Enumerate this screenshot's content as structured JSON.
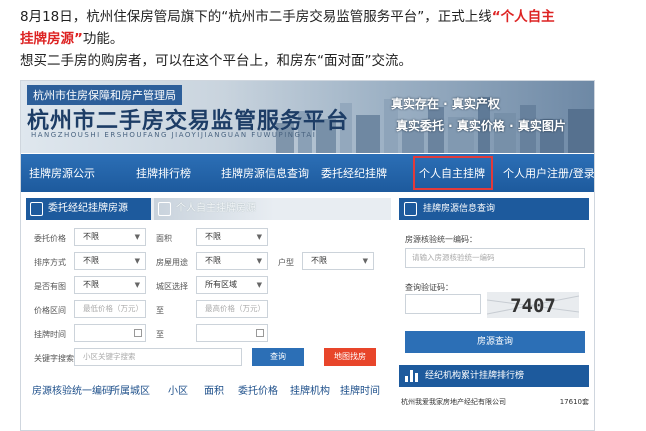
{
  "intro": {
    "line1_a": "8月18日，杭州住保房管局旗下的“杭州市二手房交易监管服务平台”，正式上线",
    "line1_b": "“个人自主",
    "line2_a": "挂牌房源”",
    "line2_b": "功能。",
    "line3": "想买二手房的购房者，可以在这个平台上，和房东“面对面”交流。"
  },
  "banner": {
    "org": "杭州市住房保障和房产管理局",
    "title": "杭州市二手房交易监管服务平台",
    "pinyin": "HANGZHOUSHI ERSHOUFANG JIAOYIJIANGUAN FUWUPINGTAI",
    "slogan1": "真实存在 · 真实产权",
    "slogan2": "真实委托 · 真实价格 · 真实图片"
  },
  "nav": {
    "items": [
      "挂牌房源公示",
      "挂牌排行榜",
      "挂牌房源信息查询",
      "委托经纪挂牌",
      "个人自主挂牌",
      "个人用户注册/登录"
    ]
  },
  "search": {
    "tab_agent": "委托经纪挂牌房源",
    "tab_personal": "个人自主挂牌房源",
    "labels": {
      "price": "委托价格",
      "area": "面积",
      "sort": "排序方式",
      "usage": "房屋用途",
      "layout": "户型",
      "has_image": "是否有图",
      "district": "城区选择",
      "price_range": "价格区间",
      "to": "至",
      "list_time": "挂牌时间",
      "keyword": "关键字搜索"
    },
    "values": {
      "price": "不限",
      "area": "不限",
      "sort": "不限",
      "usage": "不限",
      "layout": "不限",
      "has_image": "不限",
      "district": "所有区域"
    },
    "placeholders": {
      "min_price": "最低价格（万元）",
      "max_price": "最高价格（万元）",
      "keyword": "小区关键字搜索"
    },
    "query_button": "查询",
    "map_button": "地图找房"
  },
  "table": {
    "headers": [
      "房源核验统一编码",
      "所属城区",
      "小区",
      "面积",
      "委托价格",
      "挂牌机构",
      "挂牌时间"
    ]
  },
  "lookup": {
    "title": "挂牌房源信息查询",
    "code_label": "房源核验统一编码：",
    "code_placeholder": "请输入房源核验统一编码",
    "captcha_label": "查询验证码：",
    "captcha_value": "7407",
    "submit": "房源查询"
  },
  "ranking": {
    "title": "经纪机构累计挂牌排行榜",
    "agency": "杭州我爱我家房地产经纪有限公司",
    "count": "17610套"
  },
  "colors": {
    "nav": "#1d5a9d",
    "highlight_border": "#e23a3a",
    "intro_highlight": "#dd2222",
    "map_button": "#e8452a"
  }
}
